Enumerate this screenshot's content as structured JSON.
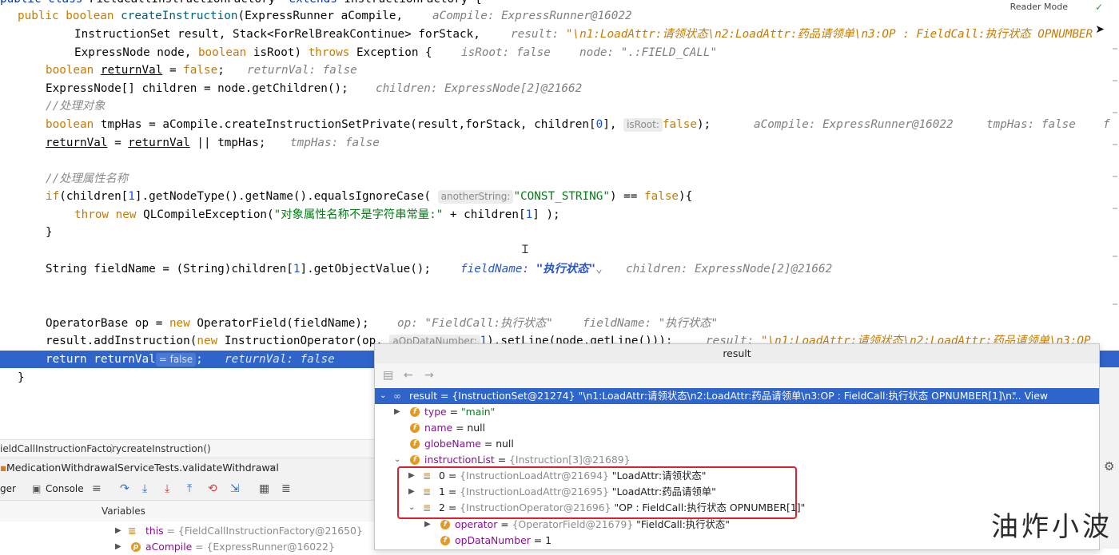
{
  "editor": {
    "top_partial": "public class FieldCallInstructionFactory  extends InstructionFactory {",
    "lines": {
      "l1": {
        "kw1": "public ",
        "kw2": "boolean ",
        "fn": "createInstruction",
        "rest": "(ExpressRunner aCompile,",
        "hint": "aCompile: ExpressRunner@16022"
      },
      "l2": {
        "code": "InstructionSet result, Stack<ForRelBreakContinue> forStack,",
        "hint_k": "result: ",
        "hint_v": "\"\\n1:LoadAttr:请领状态\\n2:LoadAttr:药品请领单\\n3:OP : FieldCall:执行状态 OPNUMBER"
      },
      "l3": {
        "code_a": "ExpressNode node, ",
        "kw": "boolean ",
        "code_b": "isRoot) ",
        "kw2": "throws ",
        "code_c": "Exception {",
        "hint1": "isRoot: false",
        "hint2": "node: \".:FIELD_CALL\""
      },
      "l4": {
        "kw": "boolean ",
        "var": "returnVal",
        "code": " = ",
        "kw2": "false",
        "end": ";",
        "hint": "returnVal: false"
      },
      "l5": {
        "code": "ExpressNode[] children = node.getChildren();",
        "hint": "children: ExpressNode[2]@21662"
      },
      "l6": {
        "comment": "//处理对象"
      },
      "l7": {
        "kw": "boolean ",
        "code_a": "tmpHas = aCompile.createInstructionSetPrivate(result,forStack, children[",
        "num": "0",
        "code_b": "],",
        "param": "isRoot:",
        "kw2": "false",
        "end": ");",
        "hint1": "aCompile: ExpressRunner@16022",
        "hint2": "tmpHas: false",
        "hint3": "f"
      },
      "l8": {
        "var1": "returnVal",
        "code": " = ",
        "var2": "returnVal",
        "code2": " || tmpHas;",
        "hint": "tmpHas: false"
      },
      "l9": {
        "comment": "//处理属性名称"
      },
      "l10": {
        "kw": "if",
        "code_a": "(children[",
        "num": "1",
        "code_b": "].getNodeType().getName().equalsIgnoreCase(",
        "param": "anotherString:",
        "str": "\"CONST_STRING\"",
        "code_c": ") == ",
        "kw2": "false",
        "code_d": "){"
      },
      "l11": {
        "kw": "throw ",
        "kw2": "new ",
        "code_a": "QLCompileException(",
        "str": "\"对象属性名称不是字符串常量:\"",
        "code_b": " + children[",
        "num": "1",
        "code_c": "] );"
      },
      "l12": {
        "code": "}"
      },
      "l13": {
        "code_a": "String fieldName = (String)children[",
        "num": "1",
        "code_b": "].getObjectValue();",
        "hint_k": "fieldName: ",
        "hint_v": "\"执行状态\"",
        "chev": "⌄",
        "hint2": "children: ExpressNode[2]@21662"
      },
      "l14": {
        "code_a": "OperatorBase op = ",
        "kw": "new ",
        "code_b": "OperatorField(fieldName);",
        "hint1": "op: \"FieldCall:执行状态\"",
        "hint2": "fieldName: \"执行状态\""
      },
      "l15": {
        "code_a": "result.addInstruction(",
        "kw": "new ",
        "code_b": "InstructionOperator(op,",
        "param": "aOpDataNumber:",
        "num": "1",
        "code_c": ").setLine(node.getLine()));",
        "hint_k": "result: ",
        "hint_v": "\"\\n1:LoadAttr:请领状态\\n2:LoadAttr:药品请领单\\n3:OP"
      },
      "l16": {
        "kw": "return ",
        "var": "returnVal",
        "param": "= false",
        "end": ";",
        "hint": "returnVal: false"
      },
      "l17": {
        "code": "}"
      }
    },
    "reader_mode": "Reader Mode"
  },
  "breadcrumb": {
    "class": "ieldCallInstructionFactory",
    "method": "createInstruction()"
  },
  "debug": {
    "session_tab": "MedicationWithdrawalServiceTests.validateWithdrawal",
    "close": "×",
    "tab_debugger": "ger",
    "tab_console": "Console",
    "variables_label": "Variables",
    "frames": [
      {
        "name": "this",
        "value": " = {FieldCallInstructionFactory@21650}"
      },
      {
        "name": "aCompile",
        "value": " = {ExpressRunner@16022}"
      }
    ]
  },
  "popup": {
    "title": "result",
    "root": {
      "name": "result",
      "value": " = {InstructionSet@21274} \"\\n1:LoadAttr:请领状态\\n2:LoadAttr:药品请领单\\n3:OP : FieldCall:执行状态 OPNUMBER[1]\\n\"",
      "view": "... View"
    },
    "fields": [
      {
        "name": "type",
        "eq": " = ",
        "value": "\"main\"",
        "kind": "str"
      },
      {
        "name": "name",
        "eq": " = ",
        "value": "null",
        "kind": "plain"
      },
      {
        "name": "globeName",
        "eq": " = ",
        "value": "null",
        "kind": "plain"
      },
      {
        "name": "instructionList",
        "eq": " = ",
        "value": "{Instruction[3]@21689}",
        "kind": "gray"
      }
    ],
    "items": [
      {
        "idx": "0",
        "ref": "{InstructionLoadAttr@21694}",
        "text": " \"LoadAttr:请领状态\""
      },
      {
        "idx": "1",
        "ref": "{InstructionLoadAttr@21695}",
        "text": " \"LoadAttr:药品请领单\""
      },
      {
        "idx": "2",
        "ref": "{InstructionOperator@21696}",
        "text": " \"OP : FieldCall:执行状态 OPNUMBER[1]\""
      }
    ],
    "sub": [
      {
        "name": "operator",
        "eq": " = ",
        "ref": "{OperatorField@21679}",
        "text": " \"FieldCall:执行状态\""
      },
      {
        "name": "opDataNumber",
        "eq": " = ",
        "ref": "",
        "text": "1"
      }
    ]
  },
  "watermark": "油炸小波"
}
